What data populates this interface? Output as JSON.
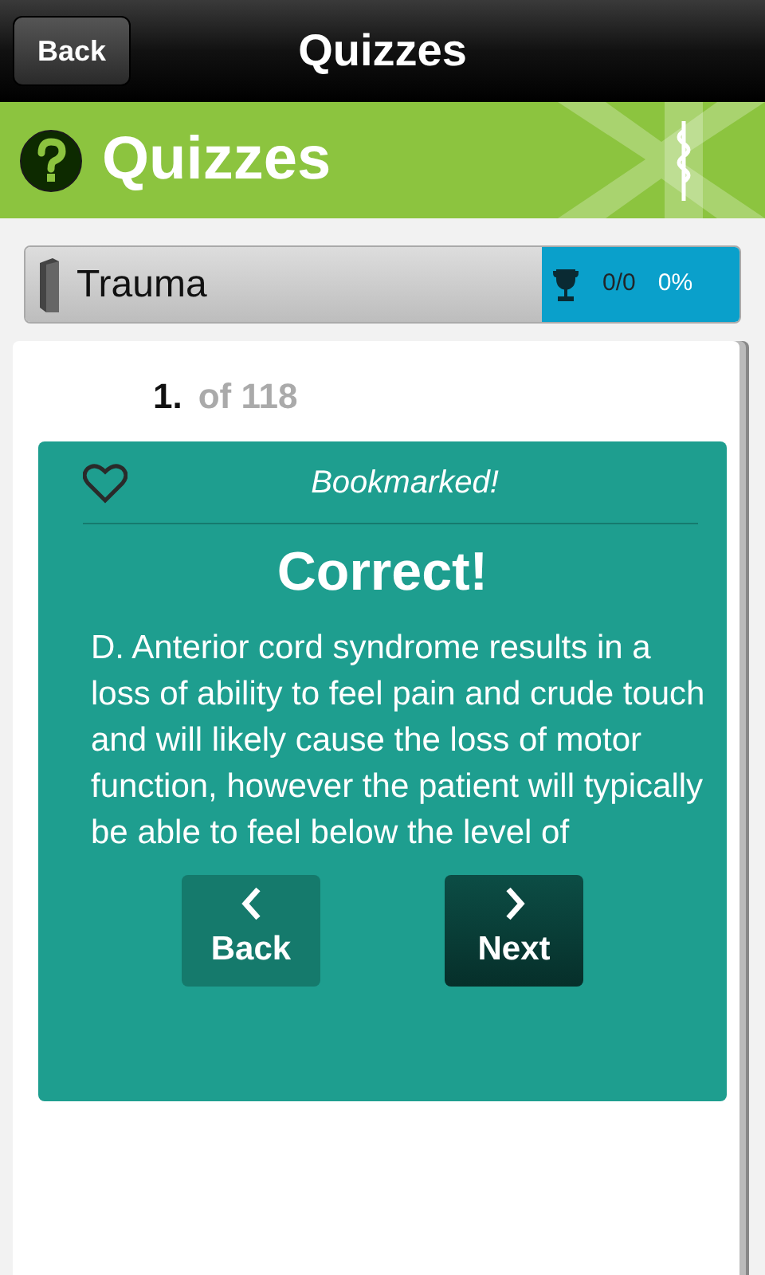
{
  "nav_bar": {
    "back_label": "Back",
    "title": "Quizzes"
  },
  "banner": {
    "title": "Quizzes"
  },
  "category": {
    "name": "Trauma",
    "score": "0/0",
    "percent": "0%"
  },
  "question": {
    "number": "1.",
    "total_label": "of 118"
  },
  "feedback": {
    "bookmark_label": "Bookmarked!",
    "result": "Correct!",
    "explanation": "D. Anterior cord syndrome results in a loss of ability to feel pain and crude touch and will likely cause the loss of motor function, however the patient will typically be able to feel below the level of",
    "buttons": [
      {
        "kind": "back",
        "label": "Back"
      },
      {
        "kind": "next",
        "label": "Next"
      }
    ]
  }
}
